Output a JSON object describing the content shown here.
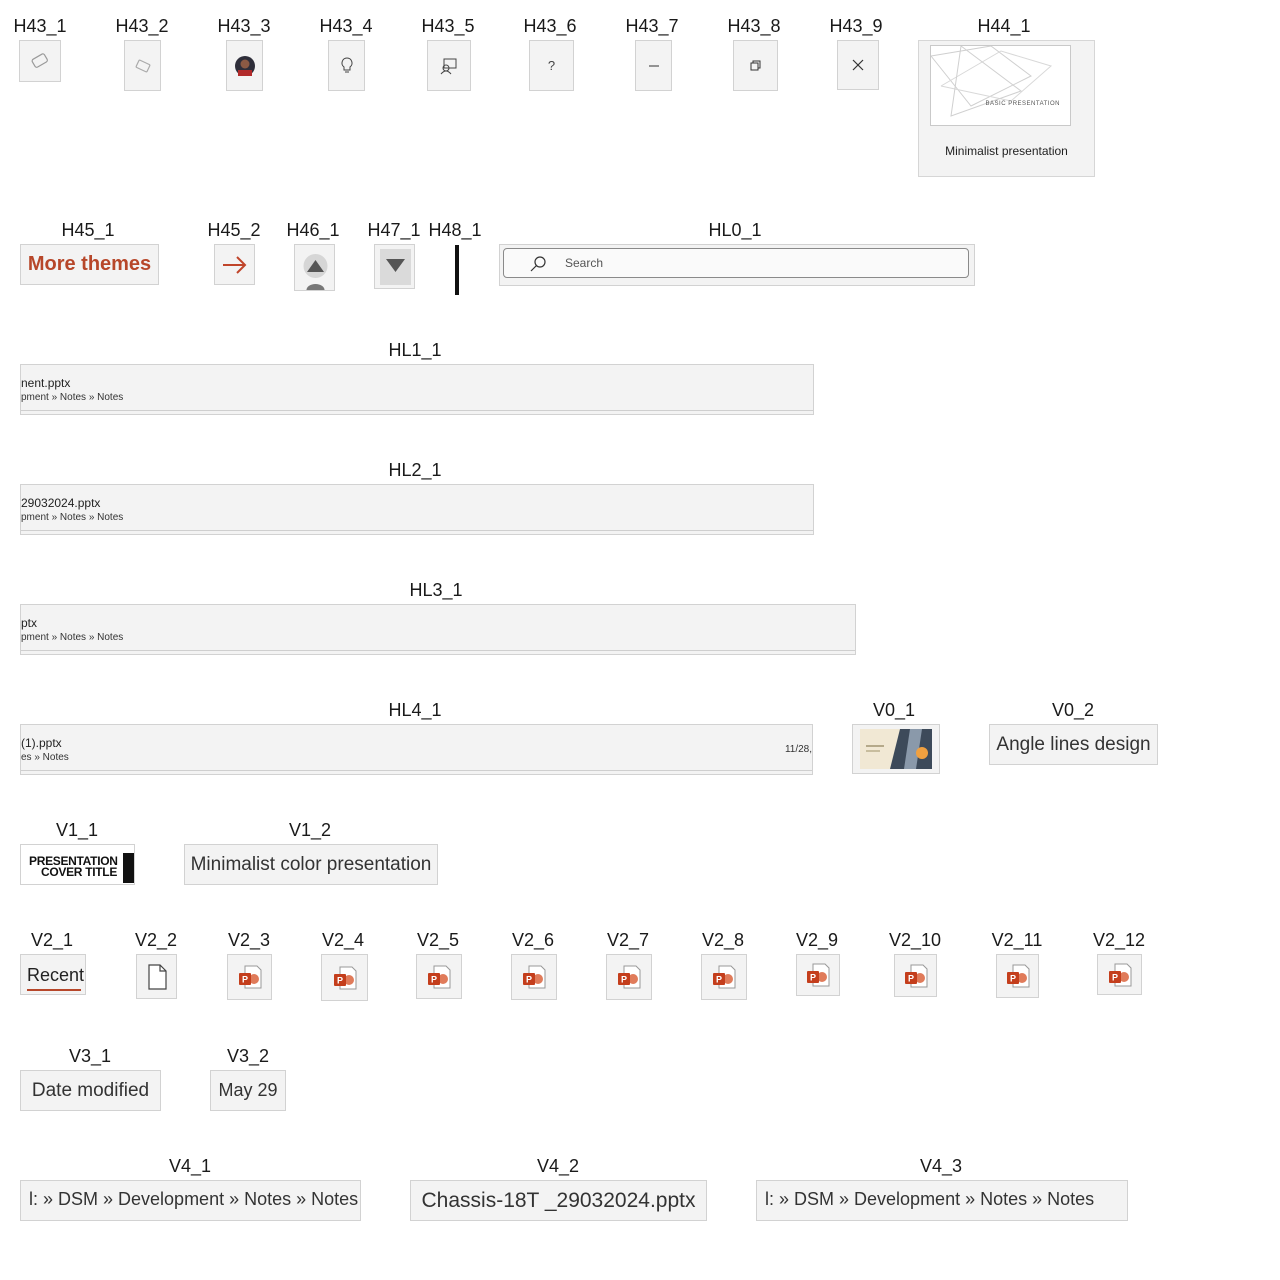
{
  "labels": {
    "h43_1": "H43_1",
    "h43_2": "H43_2",
    "h43_3": "H43_3",
    "h43_4": "H43_4",
    "h43_5": "H43_5",
    "h43_6": "H43_6",
    "h43_7": "H43_7",
    "h43_8": "H43_8",
    "h43_9": "H43_9",
    "h44_1": "H44_1",
    "h45_1": "H45_1",
    "h45_2": "H45_2",
    "h46_1": "H46_1",
    "h47_1": "H47_1",
    "h48_1": "H48_1",
    "hl0_1": "HL0_1",
    "hl1_1": "HL1_1",
    "hl2_1": "HL2_1",
    "hl3_1": "HL3_1",
    "hl4_1": "HL4_1",
    "v0_1": "V0_1",
    "v0_2": "V0_2",
    "v1_1": "V1_1",
    "v1_2": "V1_2",
    "v2_1": "V2_1",
    "v2_2": "V2_2",
    "v2_3": "V2_3",
    "v2_4": "V2_4",
    "v2_5": "V2_5",
    "v2_6": "V2_6",
    "v2_7": "V2_7",
    "v2_8": "V2_8",
    "v2_9": "V2_9",
    "v2_10": "V2_10",
    "v2_11": "V2_11",
    "v2_12": "V2_12",
    "v3_1": "V3_1",
    "v3_2": "V3_2",
    "v4_1": "V4_1",
    "v4_2": "V4_2",
    "v4_3": "V4_3"
  },
  "crops": {
    "h43_6_glyph": "?",
    "theme_card": {
      "thumb_text": "BASIC PRESENTATION",
      "name": "Minimalist presentation"
    },
    "more_themes": "More themes",
    "search_placeholder": "Search",
    "hl1": {
      "file": "nent.pptx",
      "path": "pment » Notes » Notes"
    },
    "hl2": {
      "file": "29032024.pptx",
      "path": "pment » Notes » Notes"
    },
    "hl3": {
      "file": "ptx",
      "path": "pment » Notes » Notes"
    },
    "hl4": {
      "file": "(1).pptx",
      "path": "es » Notes",
      "date": "11/28,"
    },
    "v1_1_text_line1": "PRESENTATION",
    "v1_1_text_line2": "COVER TITLE",
    "v0_2": "Angle lines design",
    "v1_2": "Minimalist color presentation",
    "v2_1": "Recent",
    "v3_1": "Date modified",
    "v3_2": "May 29",
    "v4_1": "l: » DSM » Development » Notes » Notes",
    "v4_2": "Chassis-18T _29032024.pptx",
    "v4_3": "l: » DSM » Development » Notes » Notes"
  },
  "colors": {
    "accent": "#b7472a",
    "crop_bg": "#f3f3f3",
    "border": "#d2d2d2"
  }
}
